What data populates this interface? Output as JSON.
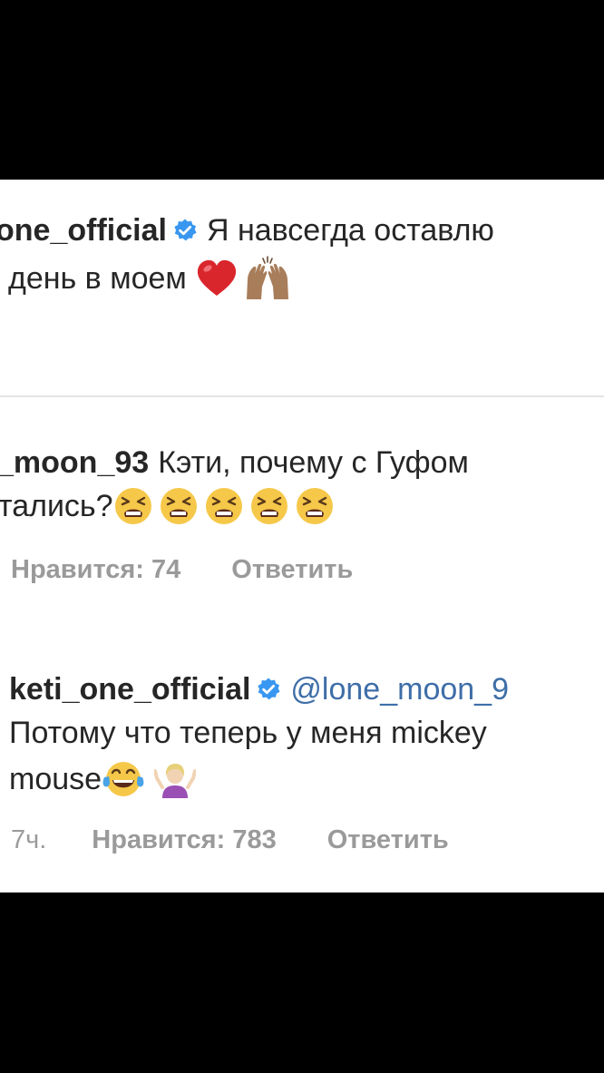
{
  "colors": {
    "background": "#000000",
    "panel": "#ffffff",
    "text": "#262626",
    "meta_text": "#9a9a9a",
    "mention": "#3f6ea8",
    "verified_badge": "#3897f0"
  },
  "comment_top": {
    "username": "one_official",
    "text_line1": "Я навсегда оставлю",
    "text_line2": "день в моем",
    "emojis": [
      "red-heart-icon",
      "raising-hands-icon"
    ]
  },
  "comment_question": {
    "username": "_moon_93",
    "text_line1": "Кэти, почему с Гуфом",
    "text_line2": "тались?",
    "emojis": [
      "tired-face-icon",
      "tired-face-icon",
      "tired-face-icon",
      "tired-face-icon",
      "tired-face-icon"
    ],
    "likes": "Нравится: 74",
    "reply": "Ответить"
  },
  "reply_comment": {
    "username": "keti_one_official",
    "mention": "@lone_moon_9",
    "text_line2": "Потому что теперь у меня mickey",
    "text_line3": "mouse",
    "emojis": [
      "tears-of-joy-icon",
      "person-shrugging-icon"
    ],
    "time": "7ч.",
    "likes": "Нравится: 783",
    "reply": "Ответить"
  }
}
